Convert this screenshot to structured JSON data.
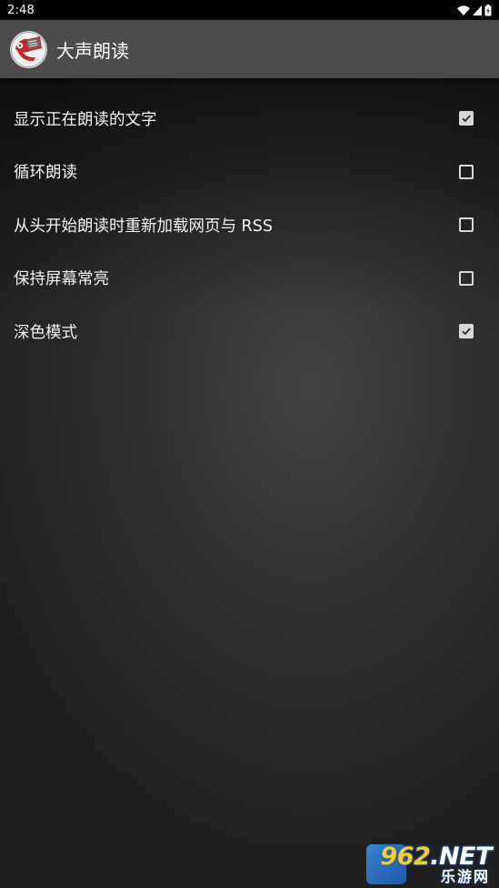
{
  "status_bar": {
    "time": "2:48",
    "icons": [
      "wifi-icon",
      "signal-icon",
      "battery-icon"
    ]
  },
  "app_bar": {
    "title": "大声朗读",
    "logo_icon": "megaphone-logo-icon",
    "background": "#4b4b4b"
  },
  "settings": [
    {
      "label": "显示正在朗读的文字",
      "checked": true
    },
    {
      "label": "循环朗读",
      "checked": false
    },
    {
      "label": "从头开始朗读时重新加载网页与 RSS",
      "checked": false
    },
    {
      "label": "保持屏幕常亮",
      "checked": false
    },
    {
      "label": "深色模式",
      "checked": true
    }
  ],
  "watermark": {
    "brand_num": "962",
    "brand_suffix": ".NET",
    "subtitle": "乐游网"
  }
}
